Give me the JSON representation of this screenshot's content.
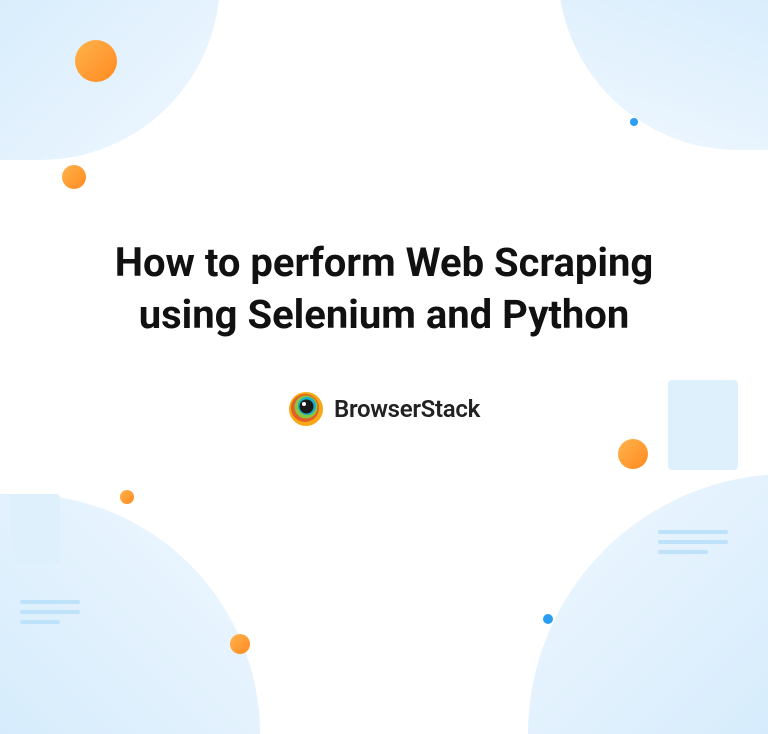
{
  "title": "How to perform Web Scraping using Selenium and Python",
  "brand": {
    "name": "BrowserStack"
  },
  "colors": {
    "accent_orange": "#ff9a2e",
    "accent_blue": "#2a9df4",
    "bg_blue_light": "#d4ebfc"
  }
}
